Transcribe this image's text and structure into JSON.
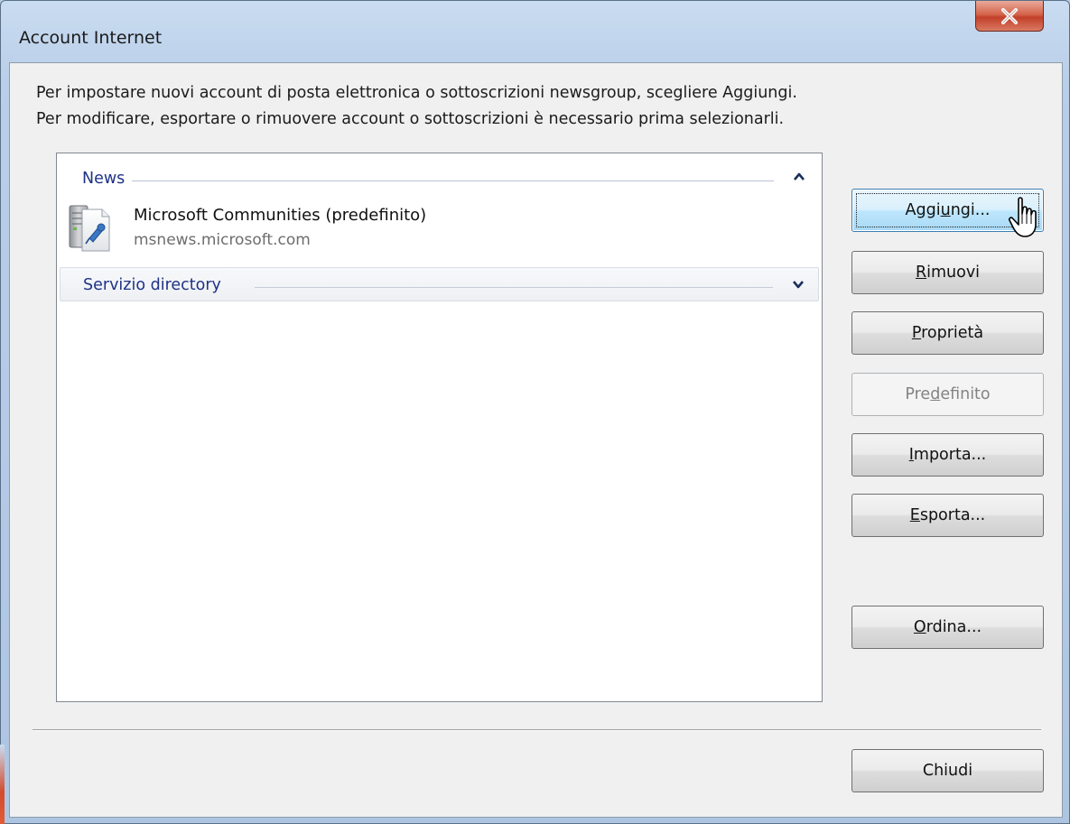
{
  "window": {
    "title": "Account Internet",
    "close_icon": "close-icon",
    "accent_color": "#3c7fb1",
    "close_color": "#c2402a"
  },
  "instructions": {
    "line1": "Per impostare nuovi account di posta elettronica o sottoscrizioni newsgroup, scegliere Aggiungi.",
    "line2": "Per modificare, esportare o rimuovere account o sottoscrizioni è necessario prima selezionarli."
  },
  "list": {
    "groups": [
      {
        "label": "News",
        "state": "expanded",
        "items": [
          {
            "name": "Microsoft Communities (predefinito)",
            "host": "msnews.microsoft.com",
            "icon": "news-server-icon"
          }
        ]
      },
      {
        "label": "Servizio directory",
        "state": "collapsed",
        "items": []
      }
    ]
  },
  "buttons": {
    "add": {
      "pre": "Aggi",
      "key": "u",
      "post": "ngi...",
      "state": "focused-hover"
    },
    "remove": {
      "pre": "",
      "key": "R",
      "post": "imuovi"
    },
    "properties": {
      "pre": "",
      "key": "P",
      "post": "roprietà"
    },
    "default": {
      "pre": "Pre",
      "key": "d",
      "post": "efinito",
      "state": "disabled"
    },
    "import": {
      "pre": "",
      "key": "I",
      "post": "mporta..."
    },
    "export": {
      "pre": "",
      "key": "E",
      "post": "sporta..."
    },
    "order": {
      "pre": "",
      "key": "O",
      "post": "rdina..."
    },
    "close": {
      "label": "Chiudi"
    }
  },
  "cursor": {
    "icon": "hand-pointer-icon"
  }
}
